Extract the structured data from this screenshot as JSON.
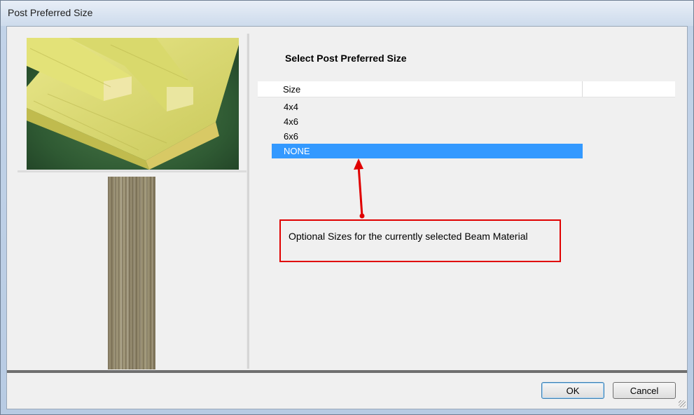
{
  "window": {
    "title": "Post Preferred Size"
  },
  "main": {
    "heading": "Select Post Preferred Size",
    "table": {
      "columns": [
        "Size",
        ""
      ],
      "rows": [
        "4x4",
        "4x6",
        "6x6",
        "NONE"
      ],
      "selected_index": 3
    },
    "annotation": {
      "text": "Optional Sizes for the currently selected Beam Material"
    }
  },
  "buttons": {
    "ok": "OK",
    "cancel": "Cancel"
  },
  "colors": {
    "selection": "#3399ff",
    "annotation": "#e00000"
  },
  "icons": {
    "preview_image": "lumber-boards-image",
    "texture_image": "wood-grain-texture"
  }
}
